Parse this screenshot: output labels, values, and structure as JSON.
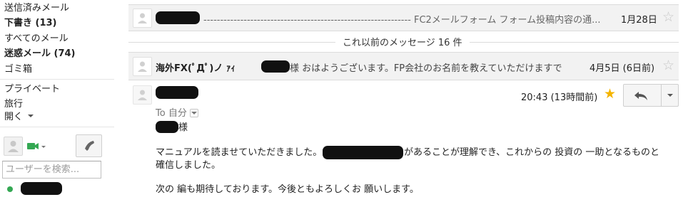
{
  "nav": {
    "sent": "送信済みメール",
    "drafts": "下書き (13)",
    "all_mail": "すべてのメール",
    "spam": "迷惑メール (74)",
    "trash": "ゴミ箱",
    "private": "プライベート",
    "travel": "旅行",
    "open": "開く"
  },
  "chat": {
    "search_placeholder": "ユーザーを検索...",
    "status_color": "#34a853"
  },
  "thread": {
    "msg1": {
      "snippet": "-------------------------------------------------------------- FC2メールフォーム フォーム投稿内容の通...",
      "date": "1月28日"
    },
    "older_messages": "これ以前のメッセージ 16 件",
    "msg2": {
      "sender": "海外FX(ﾟДﾟ)ノ ｧｨ",
      "snippet": "様 おはようございます。FP会社のお名前を教えていただけますで",
      "date": "4月5日 (6日前)"
    },
    "msg3": {
      "date": "20:43 (13時間前)",
      "to": "To 自分",
      "greeting_suffix": "様",
      "line1_a": "マニュアルを読ませていただきました。",
      "line1_b": "があることが理解でき、これからの 投資の 一助となるものと",
      "line2": "確信しました。",
      "line3": "次の 編も期待しております。今後ともよろしくお 願いします。"
    }
  },
  "colors": {
    "star_active": "#f4b400",
    "star_inactive": "#c6c6c6",
    "row_background": "#f2f2f2"
  }
}
